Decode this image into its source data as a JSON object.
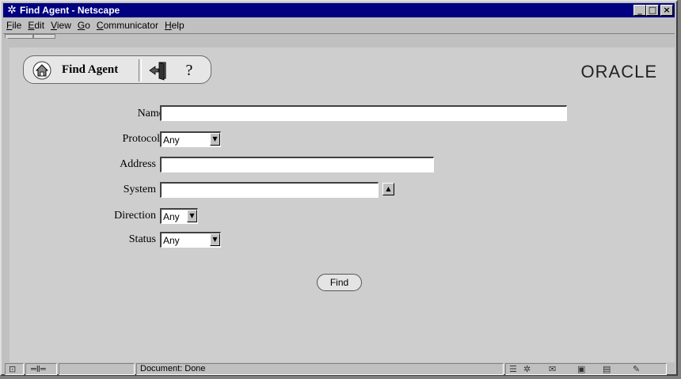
{
  "window": {
    "title": "Find Agent - Netscape",
    "controls": [
      "_",
      "□",
      "×"
    ]
  },
  "menu": [
    "File",
    "Edit",
    "View",
    "Go",
    "Communicator",
    "Help"
  ],
  "toolbar": {
    "title": "Find Agent",
    "help_glyph": "?",
    "logo": "ORACLE"
  },
  "form": {
    "name_label": "Name",
    "name_value": "",
    "protocol_label": "Protocol",
    "protocol_value": "Any",
    "address_label": "Address",
    "address_value": "",
    "system_label": "System",
    "system_value": "",
    "direction_label": "Direction",
    "direction_value": "Any",
    "status_label": "Status",
    "status_value": "Any",
    "find_label": "Find"
  },
  "statusbar": {
    "text": "Document: Done"
  }
}
